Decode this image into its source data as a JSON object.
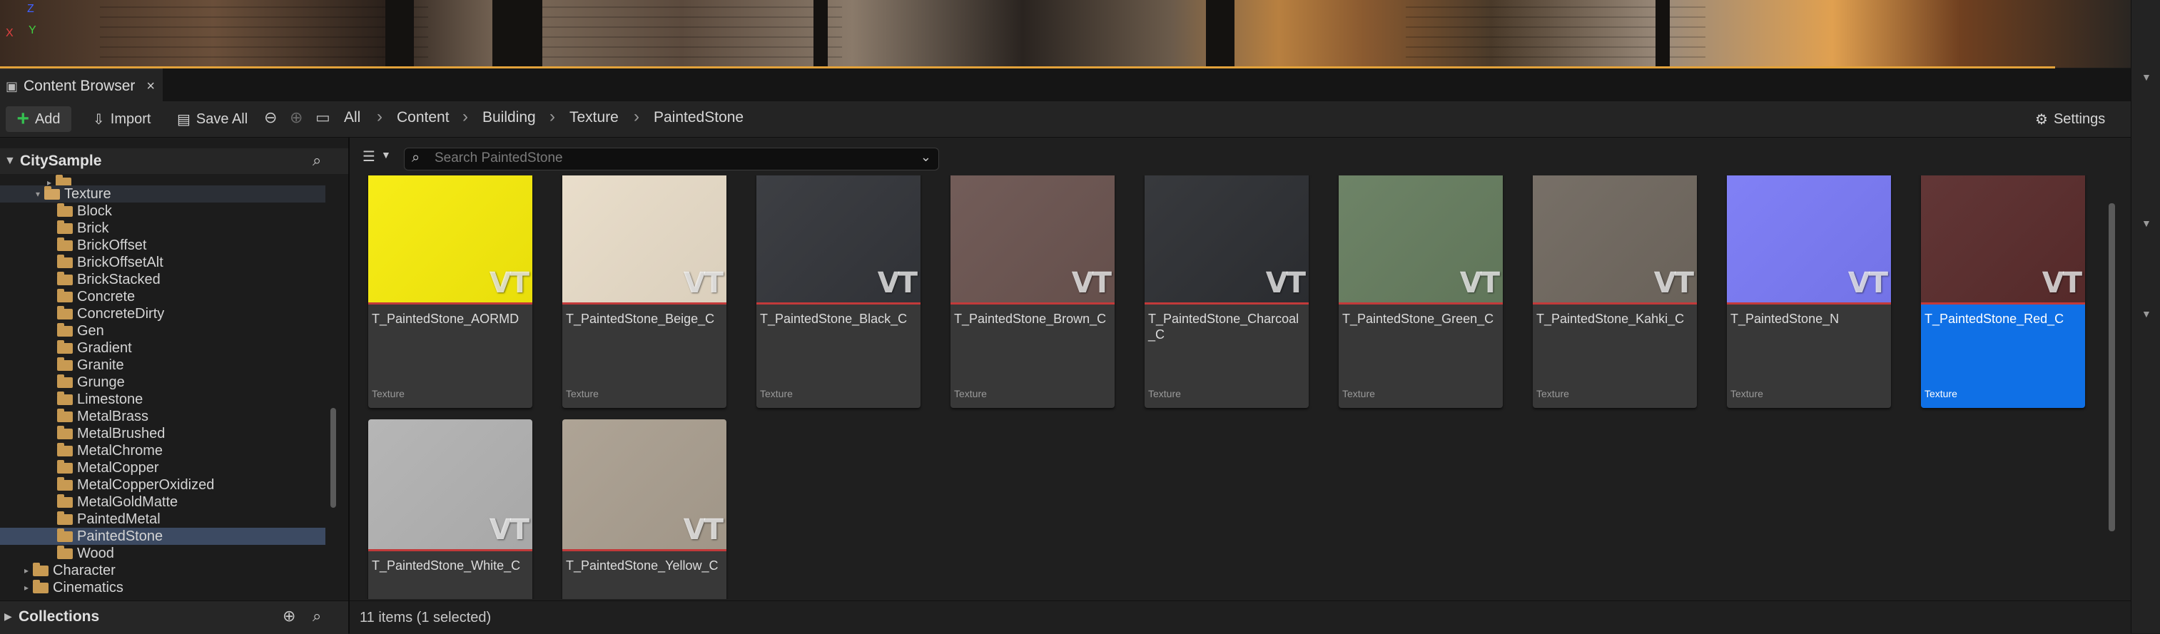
{
  "viewport": {
    "axis": {
      "x": "X",
      "y": "Y",
      "z": "Z"
    }
  },
  "tab": {
    "label": "Content Browser",
    "close": "×"
  },
  "toolbar": {
    "add_label": "Add",
    "import_label": "Import",
    "save_all_label": "Save All",
    "settings_label": "Settings"
  },
  "breadcrumb": [
    "All",
    "Content",
    "Building",
    "Texture",
    "PaintedStone"
  ],
  "tree": {
    "root_label": "CitySample",
    "parent_label": "Texture",
    "items": [
      "Block",
      "Brick",
      "BrickOffset",
      "BrickOffsetAlt",
      "BrickStacked",
      "Concrete",
      "ConcreteDirty",
      "Gen",
      "Gradient",
      "Granite",
      "Grunge",
      "Limestone",
      "MetalBrass",
      "MetalBrushed",
      "MetalChrome",
      "MetalCopper",
      "MetalCopperOxidized",
      "MetalGoldMatte",
      "PaintedMetal",
      "PaintedStone",
      "Wood"
    ],
    "selected": "PaintedStone",
    "siblings": [
      "Character",
      "Cinematics"
    ]
  },
  "collections": {
    "label": "Collections"
  },
  "search": {
    "placeholder": "Search PaintedStone"
  },
  "assets": [
    {
      "name": "T_PaintedStone_AORMD",
      "type": "Texture",
      "color": "#f7ec0b",
      "badge": "VT"
    },
    {
      "name": "T_PaintedStone_Beige_C",
      "type": "Texture",
      "color": "#e8dcc8",
      "badge": "VT"
    },
    {
      "name": "T_PaintedStone_Black_C",
      "type": "Texture",
      "color": "#33353a",
      "badge": "VT"
    },
    {
      "name": "T_PaintedStone_Brown_C",
      "type": "Texture",
      "color": "#6b5450",
      "badge": "VT"
    },
    {
      "name": "T_PaintedStone_Charcoal_C",
      "type": "Texture",
      "color": "#2d2f33",
      "badge": "VT"
    },
    {
      "name": "T_PaintedStone_Green_C",
      "type": "Texture",
      "color": "#667d5f",
      "badge": "VT"
    },
    {
      "name": "T_PaintedStone_Kahki_C",
      "type": "Texture",
      "color": "#70685f",
      "badge": "VT"
    },
    {
      "name": "T_PaintedStone_N",
      "type": "Texture",
      "color": "#7a7af5",
      "badge": "VT"
    },
    {
      "name": "T_PaintedStone_Red_C",
      "type": "Texture",
      "color": "#5a2c2c",
      "badge": "VT",
      "selected": true
    },
    {
      "name": "T_PaintedStone_White_C",
      "type": "Texture",
      "color": "#b2b2b2",
      "badge": "VT"
    },
    {
      "name": "T_PaintedStone_Yellow_C",
      "type": "Texture",
      "color": "#aa9f90",
      "badge": "VT"
    }
  ],
  "status": {
    "text": "11 items (1 selected)"
  }
}
